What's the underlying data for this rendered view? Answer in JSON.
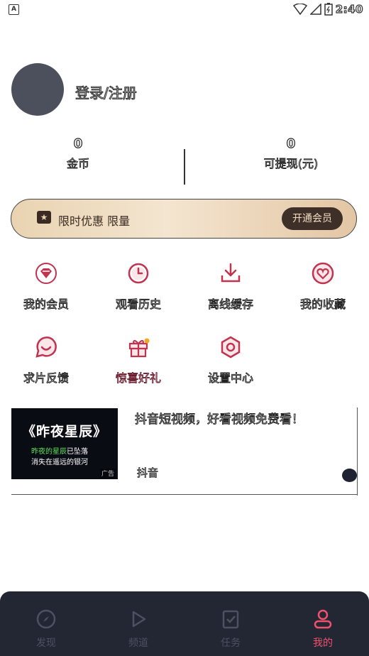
{
  "status_bar": {
    "time": "2:40"
  },
  "profile": {
    "login_label": "登录/注册"
  },
  "stats": [
    {
      "value": "0",
      "label": "金币"
    },
    {
      "value": "0",
      "label": "可提现(元)"
    }
  ],
  "vip_banner": {
    "text": "限时优惠 限量",
    "button_label": "开通会员"
  },
  "menu": [
    {
      "label": "我的会员",
      "icon": "vip-diamond-icon"
    },
    {
      "label": "观看历史",
      "icon": "clock-icon"
    },
    {
      "label": "离线缓存",
      "icon": "download-icon"
    },
    {
      "label": "我的收藏",
      "icon": "heart-icon"
    },
    {
      "label": "求片反馈",
      "icon": "feedback-icon"
    },
    {
      "label": "惊喜好礼",
      "icon": "gift-icon"
    },
    {
      "label": "设置中心",
      "icon": "settings-icon"
    }
  ],
  "ad": {
    "image_title": "《昨夜星辰》",
    "image_line1_green": "昨夜的星辰",
    "image_line1_rest": "已坠落",
    "image_line2": "消失在遥远的银河",
    "tag": "广告",
    "title": "抖音短视频，好看视频免费看！",
    "source": "抖音"
  },
  "bottom_nav": [
    {
      "label": "发现",
      "icon": "compass-icon",
      "active": false
    },
    {
      "label": "频道",
      "icon": "play-icon",
      "active": false
    },
    {
      "label": "任务",
      "icon": "task-icon",
      "active": false
    },
    {
      "label": "我的",
      "icon": "user-icon",
      "active": true
    }
  ],
  "colors": {
    "accent": "#f0516c",
    "icon_red": "#c0344f",
    "nav_bg": "#232633",
    "vip_btn": "#3e2f28"
  }
}
